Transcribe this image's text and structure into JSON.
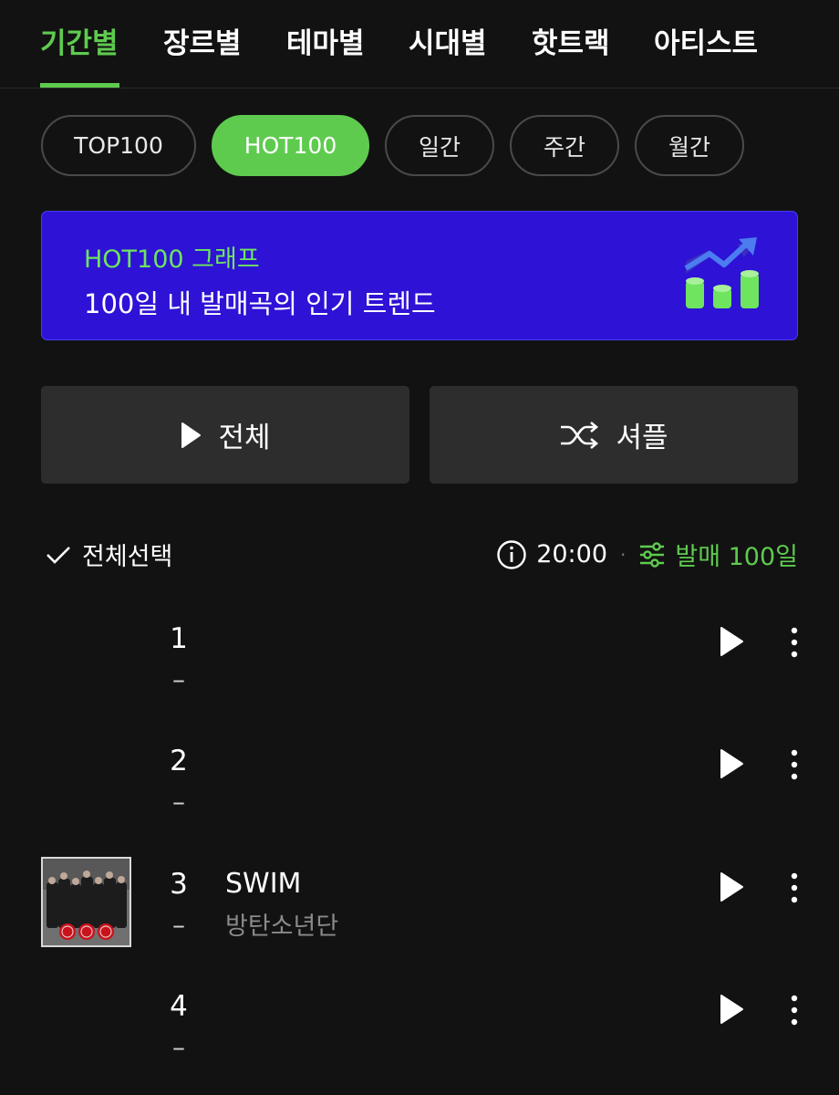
{
  "top_tabs": [
    "기간별",
    "장르별",
    "테마별",
    "시대별",
    "핫트랙",
    "아티스트"
  ],
  "active_top_tab": "기간별",
  "pills": [
    "TOP100",
    "HOT100",
    "일간",
    "주간",
    "월간"
  ],
  "active_pill": "HOT100",
  "banner": {
    "subtitle": "HOT100 그래프",
    "title": "100일 내 발매곡의 인기 트렌드",
    "icon": "trend-chart-icon"
  },
  "buttons": {
    "play_all": "전체",
    "shuffle": "셔플"
  },
  "list_header": {
    "select_all": "전체선택",
    "time": "20:00",
    "filter": "발매 100일"
  },
  "songs": [
    {
      "rank": "1",
      "change": "–",
      "title": "",
      "artist": ""
    },
    {
      "rank": "2",
      "change": "–",
      "title": "",
      "artist": ""
    },
    {
      "rank": "3",
      "change": "–",
      "title": "SWIM",
      "artist": "방탄소년단"
    },
    {
      "rank": "4",
      "change": "–",
      "title": "",
      "artist": ""
    }
  ],
  "colors": {
    "accent": "#5ecb4f",
    "background": "#121212",
    "banner": "#2e12d6",
    "button": "#2d2d2d"
  }
}
